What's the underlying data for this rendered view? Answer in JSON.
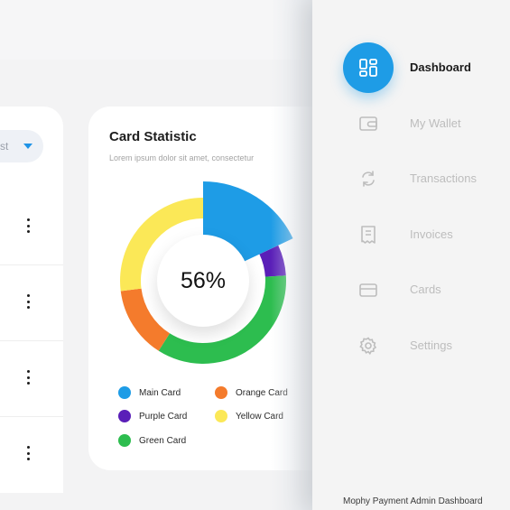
{
  "filter": {
    "value": "st"
  },
  "card": {
    "title": "Card Statistic",
    "subtitle": "Lorem ipsum dolor sit amet, consectetur",
    "center_value": "56%"
  },
  "chart_data": {
    "type": "pie",
    "center_label": "56%",
    "series": [
      {
        "name": "Main Card",
        "value": 18,
        "color": "#1e9ce6",
        "highlighted": true
      },
      {
        "name": "Purple Card",
        "value": 6,
        "color": "#5a1fb8"
      },
      {
        "name": "Green Card",
        "value": 35,
        "color": "#2dbd4f"
      },
      {
        "name": "Orange Card",
        "value": 14,
        "color": "#f47b2c"
      },
      {
        "name": "Yellow Card",
        "value": 27,
        "color": "#fbe857"
      }
    ]
  },
  "legend": [
    {
      "label": "Main Card",
      "color": "#1e9ce6"
    },
    {
      "label": "Orange Card",
      "color": "#f47b2c"
    },
    {
      "label": "Purple Card",
      "color": "#5a1fb8"
    },
    {
      "label": "Yellow Card",
      "color": "#fbe857"
    },
    {
      "label": "Green Card",
      "color": "#2dbd4f"
    }
  ],
  "sidebar": {
    "items": [
      {
        "label": "Dashboard",
        "icon": "dashboard-icon",
        "active": true
      },
      {
        "label": "My Wallet",
        "icon": "wallet-icon",
        "active": false
      },
      {
        "label": "Transactions",
        "icon": "transactions-icon",
        "active": false
      },
      {
        "label": "Invoices",
        "icon": "invoice-icon",
        "active": false
      },
      {
        "label": "Cards",
        "icon": "card-icon",
        "active": false
      },
      {
        "label": "Settings",
        "icon": "gear-icon",
        "active": false
      }
    ],
    "footer": "Mophy Payment Admin Dashboard"
  },
  "colors": {
    "accent": "#1e9ce6",
    "inactive": "#bdbdbd"
  }
}
